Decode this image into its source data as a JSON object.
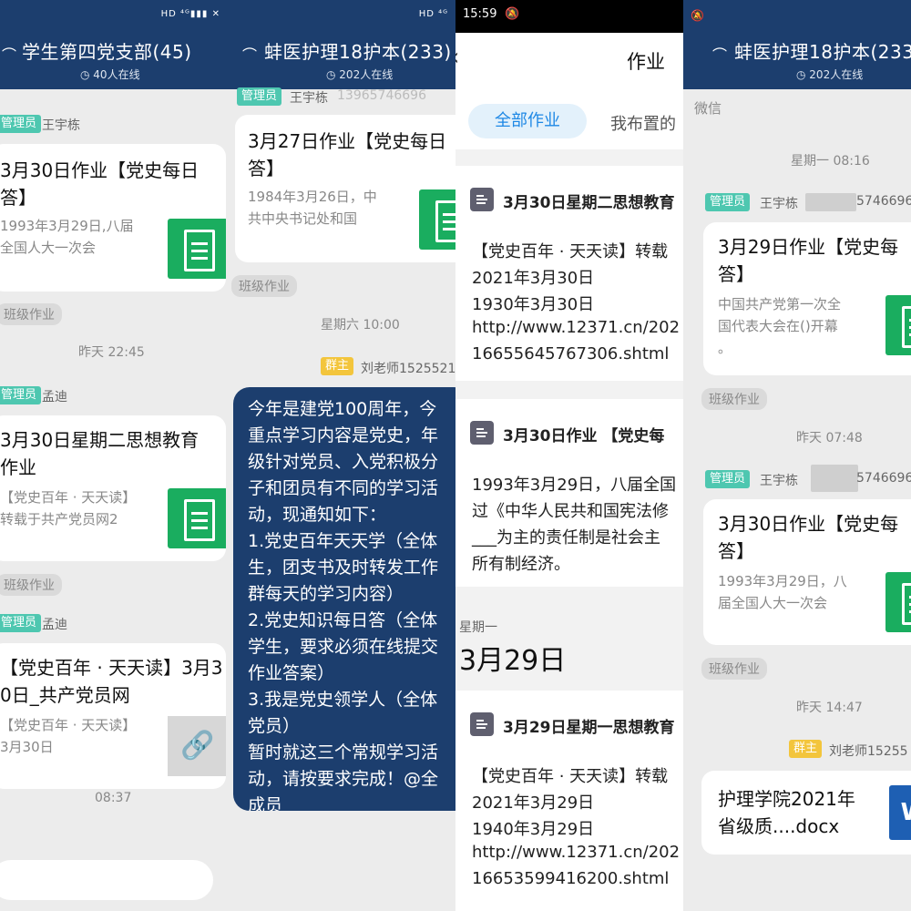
{
  "panel1": {
    "title": "学生第四党支部(45)",
    "online": "40人在线",
    "status_icons": "HD ⁴ᴳ▮▮▮ ✕",
    "msg1": {
      "role": "管理员",
      "sender": "王宇栋",
      "title": "3月30日作业【党史每日\n答】",
      "desc": "1993年3月29日,八届\n全国人大一次会"
    },
    "tag1": "班级作业",
    "time1": "昨天 22:45",
    "msg2": {
      "role": "管理员",
      "sender": "孟迪",
      "title": "3月30日星期二思想教育\n作业",
      "desc": "【党史百年 · 天天读】\n转载于共产党员网2"
    },
    "tag2": "班级作业",
    "msg3": {
      "role": "管理员",
      "sender": "孟迪",
      "title": "【党史百年 · 天天读】3月3\n0日_共产党员网",
      "desc": "【党史百年 · 天天读】\n3月30日"
    },
    "time2": "08:37"
  },
  "panel2": {
    "title": "蚌医护理18护本(233)",
    "online": "202人在线",
    "status_icons": "HD ⁴ᴳ",
    "msg1": {
      "role": "管理员",
      "sender": "王宇栋",
      "sender_extra": "13965746696",
      "title": "3月27日作业【党史每日\n答】",
      "desc": "1984年3月26日，中\n共中央书记处和国"
    },
    "tag1": "班级作业",
    "time1": "星期六 10:00",
    "msg2": {
      "role": "群主",
      "sender": "刘老师1525521"
    },
    "bubble": "今年是建党100周年，今\n重点学习内容是党史，年\n级针对党员、入党积极分\n子和团员有不同的学习活\n动，现通知如下：\n1.党史百年天天学（全体\n生，团支书及时转发工作\n群每天的学习内容）\n2.党史知识每日答（全体\n学生，要求必须在线提交\n作业答案）\n3.我是党史领学人（全体\n党员）\n暂时就这三个常规学习活\n动，请按要求完成！@全\n成员"
  },
  "panel3": {
    "status_time": "15:59",
    "title": "作业",
    "tab_all": "全部作业",
    "tab_mine": "我布置的",
    "hw1": {
      "title": "3月30日星期二思想教育",
      "lines": [
        "【党史百年 · 天天读】转载",
        "2021年3月30日",
        "1930年3月30日",
        "http://www.12371.cn/202",
        "16655645767306.shtml"
      ]
    },
    "hw2": {
      "title": "3月30日作业 【党史每",
      "lines": [
        " 1993年3月29日，八届全国",
        "过《中华人民共和国宪法修",
        "___为主的责任制是社会主",
        "所有制经济。"
      ]
    },
    "weekday": "星期一",
    "date": "3月29日",
    "hw3": {
      "title": "3月29日星期一思想教育",
      "lines": [
        "【党史百年 · 天天读】转载",
        "2021年3月29日",
        "1940年3月29日",
        "http://www.12371.cn/202",
        "16653599416200.shtml"
      ]
    }
  },
  "panel4": {
    "title": "蚌医护理18护本(233)",
    "online": "202人在线",
    "source": "微信",
    "time1": "星期一 08:16",
    "msg1": {
      "role": "管理员",
      "sender": "王宇栋",
      "sender_extra": "5746696",
      "title": "3月29日作业【党史每\n答】",
      "desc": "中国共产党第一次全\n国代表大会在()开幕\n。"
    },
    "tag1": "班级作业",
    "time2": "昨天 07:48",
    "msg2": {
      "role": "管理员",
      "sender": "王宇栋",
      "sender_extra": "5746696",
      "title": "3月30日作业【党史每\n答】",
      "desc": "1993年3月29日，八\n届全国人大一次会"
    },
    "tag2": "班级作业",
    "time3": "昨天 14:47",
    "msg3": {
      "role": "群主",
      "sender": "刘老师15255",
      "title": "护理学院2021年\n省级质....docx",
      "file_icon": "W"
    }
  }
}
